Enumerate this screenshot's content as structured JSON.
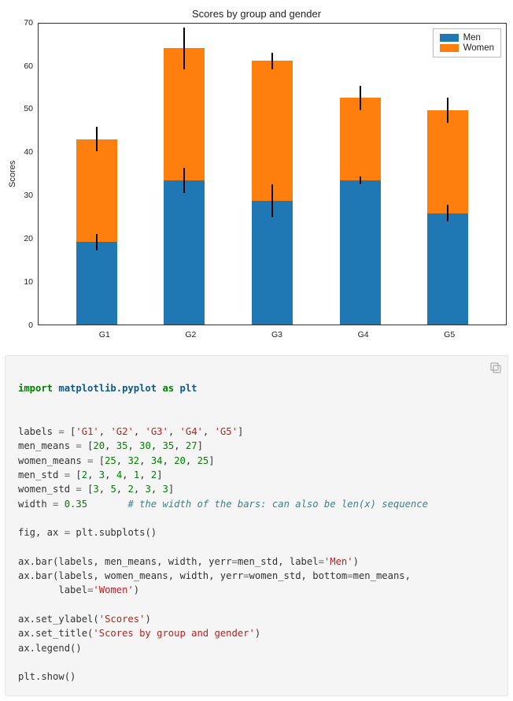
{
  "chart_data": {
    "type": "bar",
    "stacked": true,
    "title": "Scores by group and gender",
    "ylabel": "Scores",
    "xlabel": "",
    "categories": [
      "G1",
      "G2",
      "G3",
      "G4",
      "G5"
    ],
    "series": [
      {
        "name": "Men",
        "values": [
          20,
          35,
          30,
          35,
          27
        ],
        "err": [
          2,
          3,
          4,
          1,
          2
        ],
        "color": "#1f77b4"
      },
      {
        "name": "Women",
        "values": [
          25,
          32,
          34,
          20,
          25
        ],
        "err": [
          3,
          5,
          2,
          3,
          3
        ],
        "color": "#ff7f0e"
      }
    ],
    "yticks": [
      0,
      10,
      20,
      30,
      40,
      50,
      60,
      70
    ],
    "ylim": [
      0,
      73
    ],
    "legend_position": "upper right"
  },
  "legend": {
    "men": "Men",
    "women": "Women"
  },
  "code_tokens": {
    "import": "import",
    "as": "as",
    "mpl": "matplotlib.pyplot",
    "plt": "plt",
    "labels_lhs": "labels",
    "eq": "=",
    "lb": "[",
    "rb": "]",
    "g1": "'G1'",
    "g2": "'G2'",
    "g3": "'G3'",
    "g4": "'G4'",
    "g5": "'G5'",
    "c": ",",
    "men_means": "men_means",
    "women_means": "women_means",
    "men_std": "men_std",
    "women_std": "women_std",
    "mm": [
      "20",
      "35",
      "30",
      "35",
      "27"
    ],
    "wm": [
      "25",
      "32",
      "34",
      "20",
      "25"
    ],
    "ms": [
      "2",
      "3",
      "4",
      "1",
      "2"
    ],
    "ws": [
      "3",
      "5",
      "2",
      "3",
      "3"
    ],
    "width_lhs": "width",
    "width_val": "0.35",
    "width_comment": "# the width of the bars: can also be len(x) sequence",
    "fig_ax": "fig, ax",
    "subplots": "plt.subplots()",
    "bar1a": "ax.bar(labels, men_means, width, yerr",
    "bar1b": "men_std, label",
    "bar1c": "'Men'",
    "bar2a": "ax.bar(labels, women_means, width, yerr",
    "bar2b": "women_std, bottom",
    "bar2c": "men_means,",
    "bar2d": "       label",
    "bar2e": "'Women'",
    "set_ylabel": "ax.set_ylabel(",
    "ylabel_str": "'Scores'",
    "set_title": "ax.set_title(",
    "title_str": "'Scores by group and gender'",
    "legend_call": "ax.legend()",
    "show": "plt.show()",
    "rp": ")"
  }
}
